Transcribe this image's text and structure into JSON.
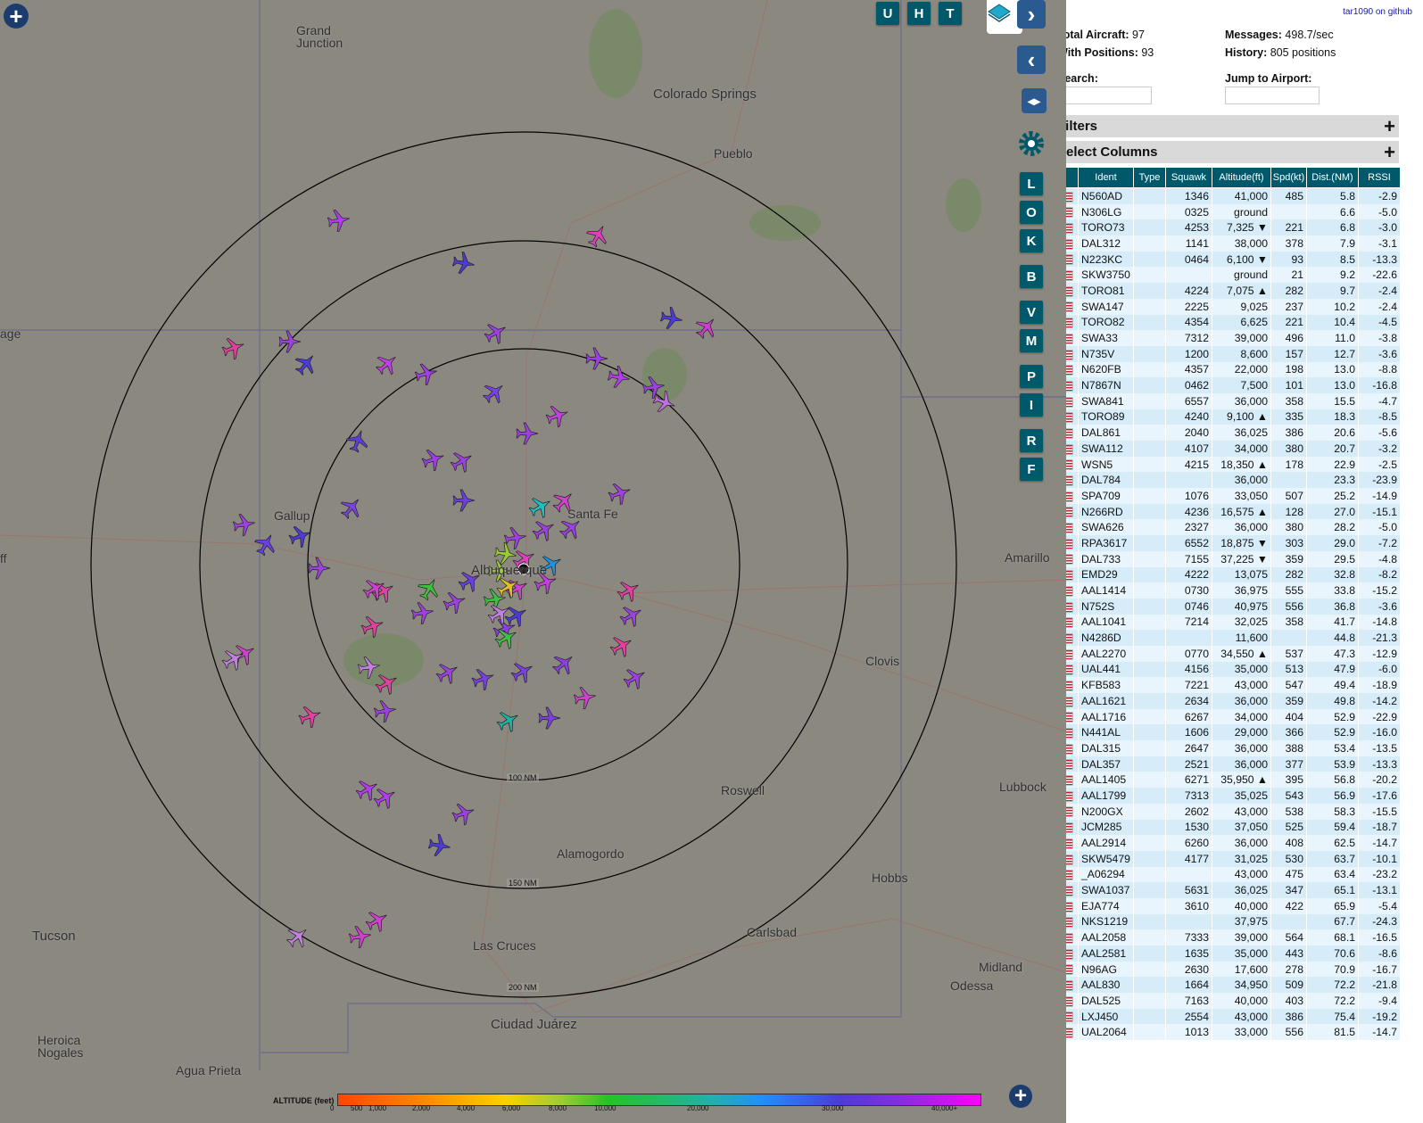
{
  "map": {
    "cities": [
      {
        "name": "Grand\nJunction",
        "big": false
      },
      {
        "name": "Colorado Springs",
        "big": true
      },
      {
        "name": "Pueblo",
        "big": false
      },
      {
        "name": "Gallup",
        "big": false
      },
      {
        "name": "Santa Fe",
        "big": false
      },
      {
        "name": "Albuquerque",
        "big": true
      },
      {
        "name": "Amarillo",
        "big": false
      },
      {
        "name": "Clovis",
        "big": false
      },
      {
        "name": "Roswell",
        "big": false
      },
      {
        "name": "Lubbock",
        "big": false
      },
      {
        "name": "Alamogordo",
        "big": false
      },
      {
        "name": "Hobbs",
        "big": false
      },
      {
        "name": "Tucson",
        "big": true
      },
      {
        "name": "Las Cruces",
        "big": false
      },
      {
        "name": "Carlsbad",
        "big": false
      },
      {
        "name": "Midland",
        "big": false
      },
      {
        "name": "Odessa",
        "big": false
      },
      {
        "name": "Ciudad Juárez",
        "big": true
      },
      {
        "name": "Heroica\nNogales",
        "big": false
      },
      {
        "name": "Agua Prieta",
        "big": false
      },
      {
        "name": "age",
        "big": false
      },
      {
        "name": "ff",
        "big": false
      }
    ],
    "range_rings": [
      "100 NM",
      "150 NM",
      "200 NM"
    ],
    "aircraft_count_shown": 93
  },
  "toolbar": {
    "top_buttons": [
      "U",
      "H",
      "T"
    ],
    "side_buttons": [
      "L",
      "O",
      "K",
      "B",
      "V",
      "M",
      "P",
      "I",
      "R",
      "F"
    ],
    "layers_icon": "layers-icon",
    "zoom_icon": "plus-icon",
    "next_icon": "chevron-right-icon",
    "prev_icon": "chevron-left-icon",
    "expand_icon": "expand-arrows-icon",
    "settings_icon": "gear-icon"
  },
  "legend": {
    "label": "ALTITUDE (feet)",
    "ticks": [
      "0",
      "500",
      "1,000",
      "2,000",
      "4,000",
      "6,000",
      "8,000",
      "10,000",
      "20,000",
      "30,000",
      "40,000+"
    ]
  },
  "panel": {
    "github_link": "tar1090 on github",
    "total_aircraft_label": "Total Aircraft:",
    "total_aircraft": "97",
    "with_positions_label": "With Positions:",
    "with_positions": "93",
    "messages_label": "Messages:",
    "messages": "498.7/sec",
    "history_label": "History:",
    "history": "805 positions",
    "search_label": "Search:",
    "jump_label": "Jump to Airport:",
    "filters_label": "Filters",
    "columns_label": "Select Columns"
  },
  "table": {
    "headers": [
      "",
      "Ident",
      "Type",
      "Squawk",
      "Altitude(ft)",
      "Spd(kt)",
      "Dist.(NM)",
      "RSSI"
    ],
    "rows": [
      [
        "N560AD",
        "",
        "1346",
        "41,000",
        "485",
        "5.8",
        "-2.9"
      ],
      [
        "N306LG",
        "",
        "0325",
        "ground",
        "",
        "6.6",
        "-5.0"
      ],
      [
        "TORO73",
        "",
        "4253",
        "7,325 ▼",
        "221",
        "6.8",
        "-3.0"
      ],
      [
        "DAL312",
        "",
        "1141",
        "38,000",
        "378",
        "7.9",
        "-3.1"
      ],
      [
        "N223KC",
        "",
        "0464",
        "6,100 ▼",
        "93",
        "8.5",
        "-13.3"
      ],
      [
        "SKW3750",
        "",
        "",
        "ground",
        "21",
        "9.2",
        "-22.6"
      ],
      [
        "TORO81",
        "",
        "4224",
        "7,075 ▲",
        "282",
        "9.7",
        "-2.4"
      ],
      [
        "SWA147",
        "",
        "2225",
        "9,025",
        "237",
        "10.2",
        "-2.4"
      ],
      [
        "TORO82",
        "",
        "4354",
        "6,625",
        "221",
        "10.4",
        "-4.5"
      ],
      [
        "SWA33",
        "",
        "7312",
        "39,000",
        "496",
        "11.0",
        "-3.8"
      ],
      [
        "N735V",
        "",
        "1200",
        "8,600",
        "157",
        "12.7",
        "-3.6"
      ],
      [
        "N620FB",
        "",
        "4357",
        "22,000",
        "198",
        "13.0",
        "-8.8"
      ],
      [
        "N7867N",
        "",
        "0462",
        "7,500",
        "101",
        "13.0",
        "-16.8"
      ],
      [
        "SWA841",
        "",
        "6557",
        "36,000",
        "358",
        "15.5",
        "-4.7"
      ],
      [
        "TORO89",
        "",
        "4240",
        "9,100 ▲",
        "335",
        "18.3",
        "-8.5"
      ],
      [
        "DAL861",
        "",
        "2040",
        "36,025",
        "386",
        "20.6",
        "-5.6"
      ],
      [
        "SWA112",
        "",
        "4107",
        "34,000",
        "380",
        "20.7",
        "-3.2"
      ],
      [
        "WSN5",
        "",
        "4215",
        "18,350 ▲",
        "178",
        "22.9",
        "-2.5"
      ],
      [
        "DAL784",
        "",
        "",
        "36,000",
        "",
        "23.3",
        "-23.9"
      ],
      [
        "SPA709",
        "",
        "1076",
        "33,050",
        "507",
        "25.2",
        "-14.9"
      ],
      [
        "N266RD",
        "",
        "4236",
        "16,575 ▲",
        "128",
        "27.0",
        "-15.1"
      ],
      [
        "SWA626",
        "",
        "2327",
        "36,000",
        "380",
        "28.2",
        "-5.0"
      ],
      [
        "RPA3617",
        "",
        "6552",
        "18,875 ▼",
        "303",
        "29.0",
        "-7.2"
      ],
      [
        "DAL733",
        "",
        "7155",
        "37,225 ▼",
        "359",
        "29.5",
        "-4.8"
      ],
      [
        "EMD29",
        "",
        "4222",
        "13,075",
        "282",
        "32.8",
        "-8.2"
      ],
      [
        "AAL1414",
        "",
        "0730",
        "36,975",
        "555",
        "33.8",
        "-15.2"
      ],
      [
        "N752S",
        "",
        "0746",
        "40,975",
        "556",
        "36.8",
        "-3.6"
      ],
      [
        "AAL1041",
        "",
        "7214",
        "32,025",
        "358",
        "41.7",
        "-14.8"
      ],
      [
        "N4286D",
        "",
        "",
        "11,600",
        "",
        "44.8",
        "-21.3"
      ],
      [
        "AAL2270",
        "",
        "0770",
        "34,550 ▲",
        "537",
        "47.3",
        "-12.9"
      ],
      [
        "UAL441",
        "",
        "4156",
        "35,000",
        "513",
        "47.9",
        "-6.0"
      ],
      [
        "KFB583",
        "",
        "7221",
        "43,000",
        "547",
        "49.4",
        "-18.9"
      ],
      [
        "AAL1621",
        "",
        "2634",
        "36,000",
        "359",
        "49.8",
        "-14.2"
      ],
      [
        "AAL1716",
        "",
        "6267",
        "34,000",
        "404",
        "52.9",
        "-22.9"
      ],
      [
        "N441AL",
        "",
        "1606",
        "29,000",
        "366",
        "52.9",
        "-16.0"
      ],
      [
        "DAL315",
        "",
        "2647",
        "36,000",
        "388",
        "53.4",
        "-13.5"
      ],
      [
        "DAL357",
        "",
        "2521",
        "36,000",
        "377",
        "53.9",
        "-13.3"
      ],
      [
        "AAL1405",
        "",
        "6271",
        "35,950 ▲",
        "395",
        "56.8",
        "-20.2"
      ],
      [
        "AAL1799",
        "",
        "7313",
        "35,025",
        "543",
        "56.9",
        "-17.6"
      ],
      [
        "N200GX",
        "",
        "2602",
        "43,000",
        "538",
        "58.3",
        "-15.5"
      ],
      [
        "JCM285",
        "",
        "1530",
        "37,050",
        "525",
        "59.4",
        "-18.7"
      ],
      [
        "AAL2914",
        "",
        "6260",
        "36,000",
        "408",
        "62.5",
        "-14.7"
      ],
      [
        "SKW5479",
        "",
        "4177",
        "31,025",
        "530",
        "63.7",
        "-10.1"
      ],
      [
        "_A06294",
        "",
        "",
        "43,000",
        "475",
        "63.4",
        "-23.2"
      ],
      [
        "SWA1037",
        "",
        "5631",
        "36,025",
        "347",
        "65.1",
        "-13.1"
      ],
      [
        "EJA774",
        "",
        "3610",
        "40,000",
        "422",
        "65.9",
        "-5.4"
      ],
      [
        "NKS1219",
        "",
        "",
        "37,975",
        "",
        "67.7",
        "-24.3"
      ],
      [
        "AAL2058",
        "",
        "7333",
        "39,000",
        "564",
        "68.1",
        "-16.5"
      ],
      [
        "AAL2581",
        "",
        "1635",
        "35,000",
        "443",
        "70.6",
        "-8.6"
      ],
      [
        "N96AG",
        "",
        "2630",
        "17,600",
        "278",
        "70.9",
        "-16.7"
      ],
      [
        "AAL830",
        "",
        "1664",
        "34,950",
        "509",
        "72.2",
        "-21.8"
      ],
      [
        "DAL525",
        "",
        "7163",
        "40,000",
        "403",
        "72.2",
        "-9.4"
      ],
      [
        "LXJ450",
        "",
        "2554",
        "43,000",
        "386",
        "75.4",
        "-19.2"
      ],
      [
        "UAL2064",
        "",
        "1013",
        "33,000",
        "556",
        "81.5",
        "-14.7"
      ]
    ]
  }
}
